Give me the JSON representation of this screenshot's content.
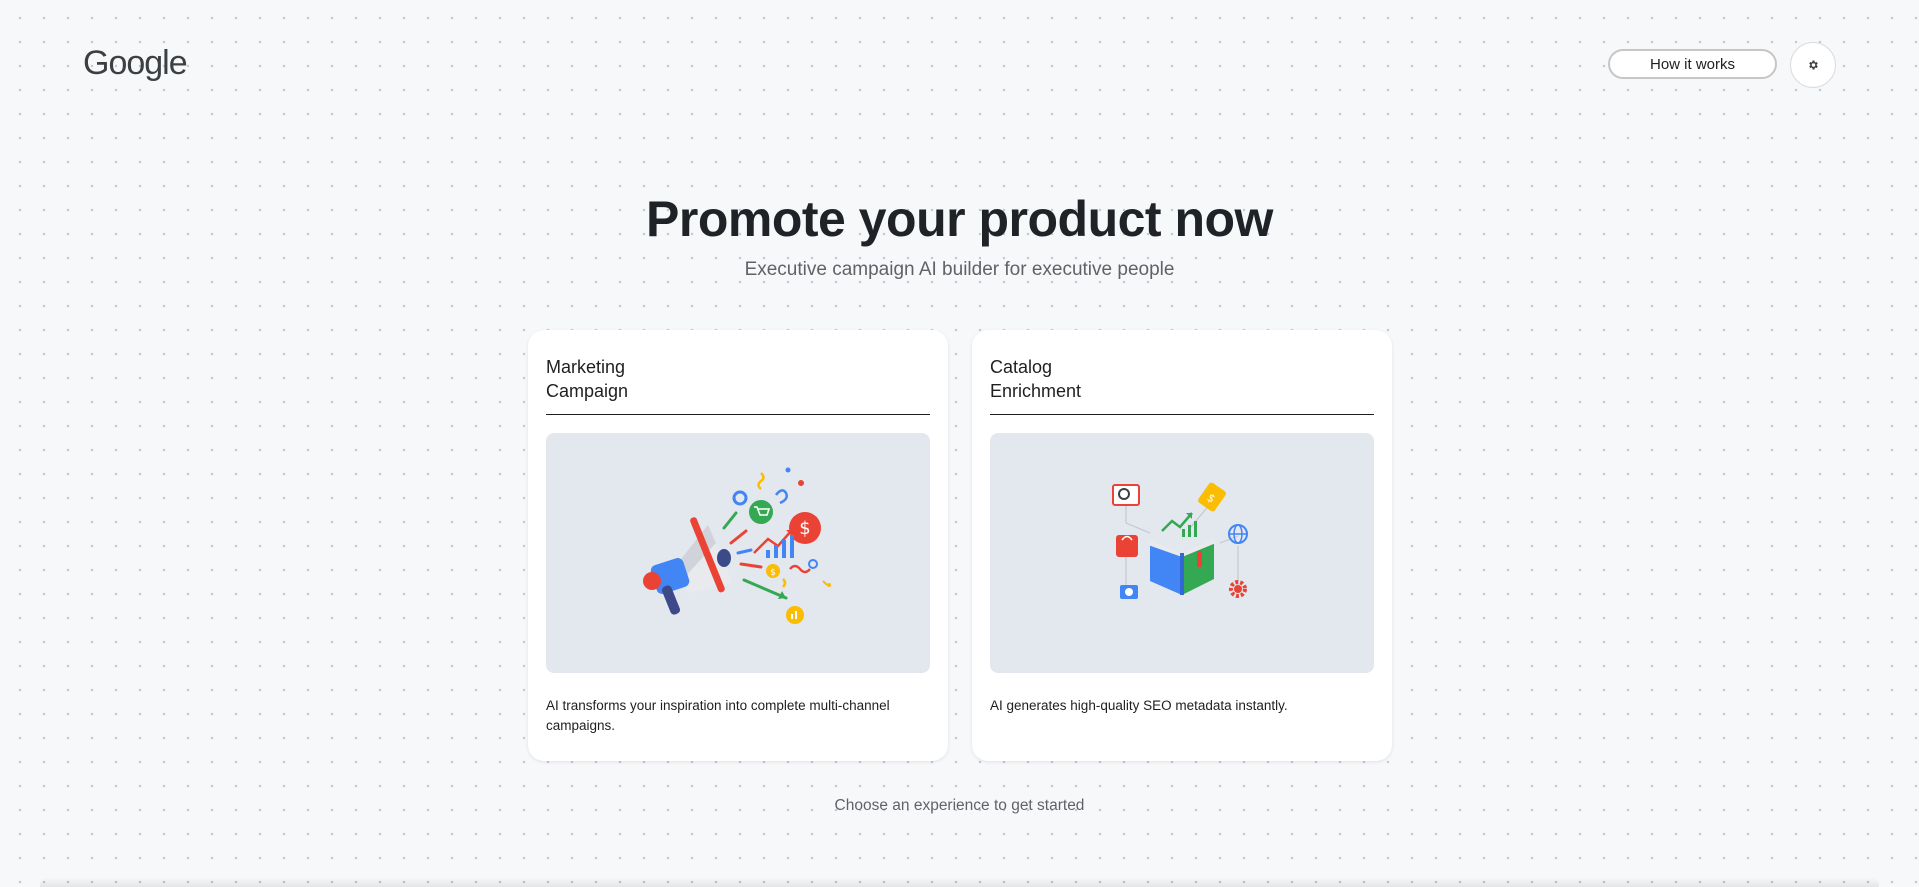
{
  "header": {
    "logo_text": "Google",
    "how_it_works_label": "How it works",
    "settings_icon": "gear-icon"
  },
  "hero": {
    "title": "Promote your product now",
    "subtitle": "Executive campaign AI builder for executive people"
  },
  "cards": [
    {
      "title_line1": "Marketing",
      "title_line2": "Campaign",
      "description": "AI transforms your inspiration into complete multi-channel campaigns.",
      "illustration": "megaphone-illustration"
    },
    {
      "title_line1": "Catalog",
      "title_line2": "Enrichment",
      "description": "AI generates high-quality SEO metadata instantly.",
      "illustration": "book-illustration"
    }
  ],
  "footer": {
    "hint": "Choose an experience to get started"
  },
  "colors": {
    "background": "#f7f8fa",
    "card_image_bg": "#e3e7ee",
    "google_blue": "#4285f4",
    "google_red": "#ea4335",
    "google_yellow": "#fbbc04",
    "google_green": "#34a853"
  }
}
